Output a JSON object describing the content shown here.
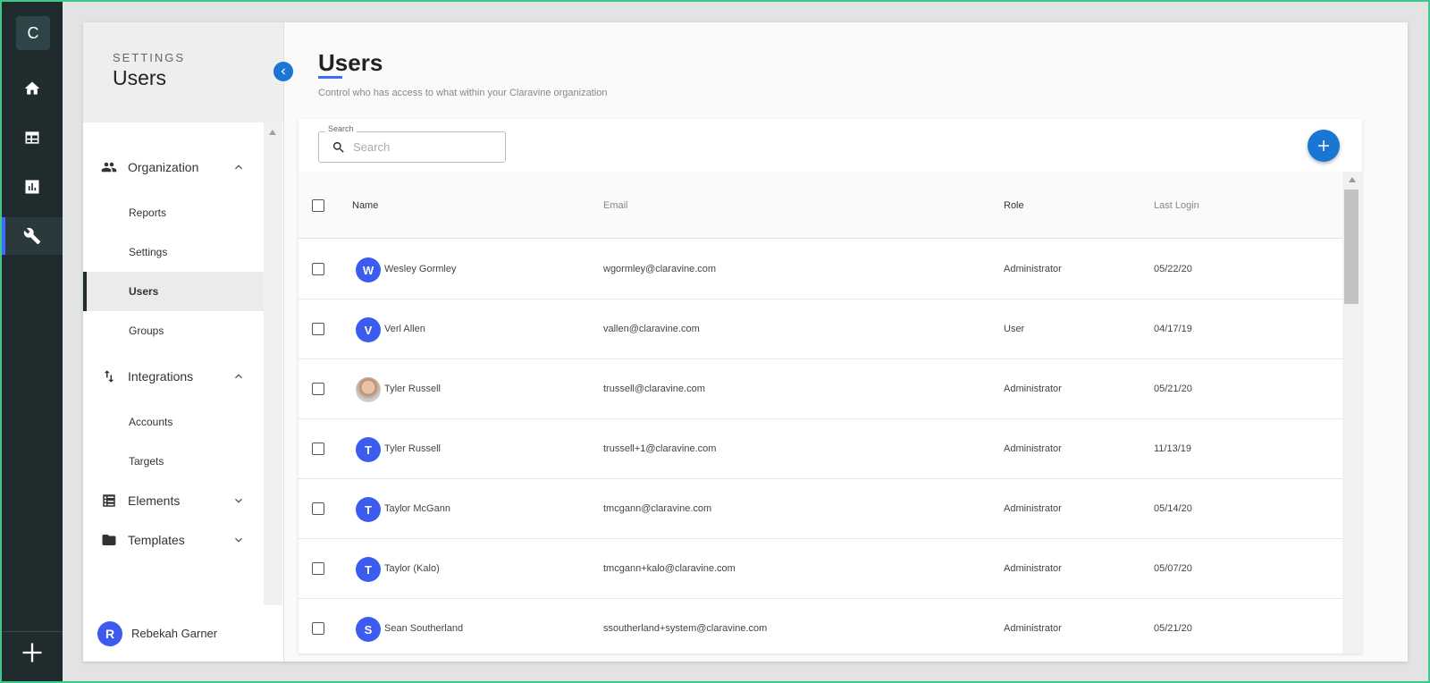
{
  "rail": {
    "logo_letter": "C",
    "items": [
      {
        "icon": "home-icon"
      },
      {
        "icon": "table-icon"
      },
      {
        "icon": "chart-icon"
      },
      {
        "icon": "wrench-icon",
        "active": true
      }
    ],
    "add_icon": "plus-icon"
  },
  "sidebar": {
    "eyebrow": "SETTINGS",
    "title": "Users",
    "groups": [
      {
        "label": "Organization",
        "icon": "people-icon",
        "expanded": true,
        "items": [
          {
            "label": "Reports"
          },
          {
            "label": "Settings"
          },
          {
            "label": "Users",
            "active": true
          },
          {
            "label": "Groups"
          }
        ]
      },
      {
        "label": "Integrations",
        "icon": "swap-icon",
        "expanded": true,
        "items": [
          {
            "label": "Accounts"
          },
          {
            "label": "Targets"
          }
        ]
      },
      {
        "label": "Elements",
        "icon": "list-icon",
        "expanded": false,
        "items": []
      },
      {
        "label": "Templates",
        "icon": "folder-icon",
        "expanded": false,
        "items": []
      }
    ],
    "user": {
      "initial": "R",
      "name": "Rebekah Garner"
    }
  },
  "main": {
    "title": "Users",
    "subtitle": "Control who has access to what within your Claravine organization",
    "search": {
      "legend": "Search",
      "placeholder": "Search",
      "value": ""
    },
    "columns": {
      "name": "Name",
      "email": "Email",
      "role": "Role",
      "last_login": "Last Login"
    },
    "rows": [
      {
        "initial": "W",
        "name": "Wesley Gormley",
        "email": "wgormley@claravine.com",
        "role": "Administrator",
        "last_login": "05/22/20"
      },
      {
        "initial": "V",
        "name": "Verl Allen",
        "email": "vallen@claravine.com",
        "role": "User",
        "last_login": "04/17/19"
      },
      {
        "initial": "",
        "photo": true,
        "name": "Tyler Russell",
        "email": "trussell@claravine.com",
        "role": "Administrator",
        "last_login": "05/21/20"
      },
      {
        "initial": "T",
        "name": "Tyler Russell",
        "email": "trussell+1@claravine.com",
        "role": "Administrator",
        "last_login": "11/13/19"
      },
      {
        "initial": "T",
        "name": "Taylor McGann",
        "email": "tmcgann@claravine.com",
        "role": "Administrator",
        "last_login": "05/14/20"
      },
      {
        "initial": "T",
        "name": "Taylor (Kalo)",
        "email": "tmcgann+kalo@claravine.com",
        "role": "Administrator",
        "last_login": "05/07/20"
      },
      {
        "initial": "S",
        "name": "Sean Southerland",
        "email": "ssoutherland+system@claravine.com",
        "role": "Administrator",
        "last_login": "05/21/20"
      }
    ]
  },
  "colors": {
    "accent": "#3d6bff",
    "primary_button": "#1976d2",
    "rail_bg": "#1f2b2c",
    "avatar": "#3c5cf0"
  }
}
